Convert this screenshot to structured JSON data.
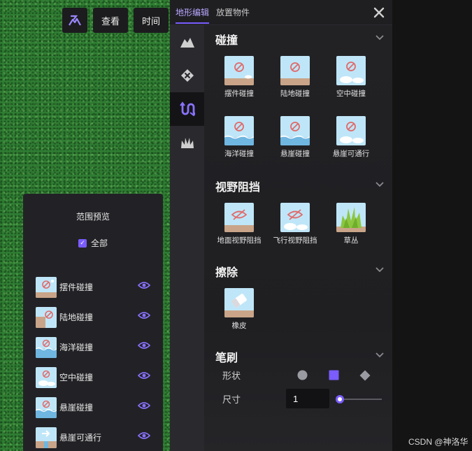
{
  "toolbar": {
    "terrain_icon": "terrain-edit-icon",
    "view_label": "查看",
    "time_label": "时间"
  },
  "range_preview": {
    "title": "范围预览",
    "select_all_label": "全部",
    "select_all_checked": true,
    "items": [
      {
        "label": "摆件碰撞",
        "thumb": "prop"
      },
      {
        "label": "陆地碰撞",
        "thumb": "land"
      },
      {
        "label": "海洋碰撞",
        "thumb": "ocean"
      },
      {
        "label": "空中碰撞",
        "thumb": "air"
      },
      {
        "label": "悬崖碰撞",
        "thumb": "cliff"
      },
      {
        "label": "悬崖可通行",
        "thumb": "cliff-pass"
      }
    ]
  },
  "panel": {
    "tabs": [
      {
        "label": "地形编辑",
        "active": true
      },
      {
        "label": "放置物件",
        "active": false
      }
    ],
    "rail": [
      {
        "icon": "mountain-icon",
        "active": false
      },
      {
        "icon": "block-icon",
        "active": false
      },
      {
        "icon": "collision-path-icon",
        "active": true
      },
      {
        "icon": "grass-icon",
        "active": false
      }
    ],
    "sections": {
      "collision": {
        "title": "碰撞",
        "tiles": [
          {
            "label": "摆件碰撞",
            "art": "prop"
          },
          {
            "label": "陆地碰撞",
            "art": "land"
          },
          {
            "label": "空中碰撞",
            "art": "air"
          },
          {
            "label": "海洋碰撞",
            "art": "ocean"
          },
          {
            "label": "悬崖碰撞",
            "art": "cliff"
          },
          {
            "label": "悬崖可通行",
            "art": "cliff-pass"
          }
        ]
      },
      "vision": {
        "title": "视野阻挡",
        "tiles": [
          {
            "label": "地面视野阻挡",
            "art": "ground-vision"
          },
          {
            "label": "飞行视野阻挡",
            "art": "air-vision"
          },
          {
            "label": "草丛",
            "art": "bush"
          }
        ]
      },
      "erase": {
        "title": "擦除",
        "tiles": [
          {
            "label": "橡皮",
            "art": "eraser"
          }
        ]
      },
      "brush": {
        "title": "笔刷",
        "shape_label": "形状",
        "shapes": [
          "circle",
          "square",
          "diamond"
        ],
        "selected_shape": "square",
        "size_label": "尺寸",
        "size_value": "1",
        "size_slider_fraction": 0
      }
    }
  },
  "watermark": "CSDN @神洛华",
  "colors": {
    "accent": "#7a5cff",
    "panel_bg": "#1f1f22",
    "rail_bg": "#2a2a2e",
    "sky": "#bfe6f8",
    "ground": "#c9a488",
    "water": "#6fb6e0",
    "forbid": "#e06a6a"
  }
}
